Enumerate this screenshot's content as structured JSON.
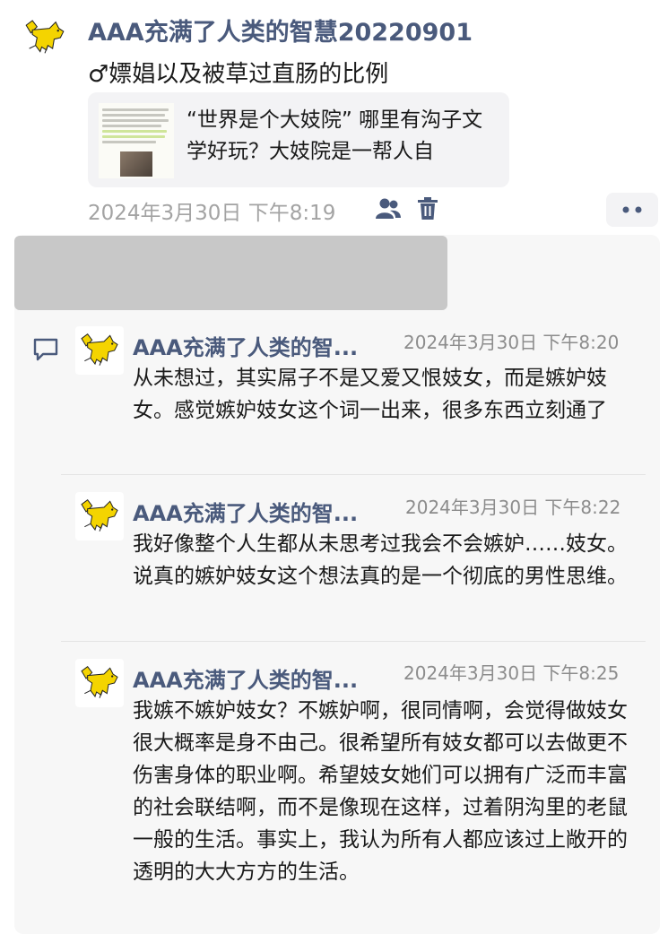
{
  "post": {
    "author": "AAA充满了人类的智慧20220901",
    "text": "♂嫖娼以及被草过直肠的比例",
    "link_card": {
      "title": "“世界是个大妓院” 哪里有沟子文学好玩？大妓院是一帮人自"
    },
    "timestamp": "2024年3月30日 下午8:19",
    "icons": {
      "audience": "people-icon",
      "delete": "trash-icon",
      "more": "more-dots-icon"
    }
  },
  "comments": [
    {
      "author": "AAA充满了人类的智...",
      "time": "2024年3月30日 下午8:20",
      "text": "从未想过，其实屌子不是又爱又恨妓女，而是嫉妒妓女。感觉嫉妒妓女这个词一出来，很多东西立刻通了"
    },
    {
      "author": "AAA充满了人类的智...",
      "time": "2024年3月30日 下午8:22",
      "text": "我好像整个人生都从未思考过我会不会嫉妒……妓女。说真的嫉妒妓女这个想法真的是一个彻底的男性思维。"
    },
    {
      "author": "AAA充满了人类的智...",
      "time": "2024年3月30日 下午8:25",
      "text": "我嫉不嫉妒妓女？不嫉妒啊，很同情啊，会觉得做妓女很大概率是身不由己。很希望所有妓女都可以去做更不伤害身体的职业啊。希望妓女她们可以拥有广泛而丰富的社会联结啊，而不是像现在这样，过着阴沟里的老鼠一般的生活。事实上，我认为所有人都应该过上敞开的透明的大大方方的生活。"
    }
  ],
  "colors": {
    "name": "#4a5a7c",
    "accent": "#4a5a7c",
    "meta": "#a3a3a3"
  }
}
